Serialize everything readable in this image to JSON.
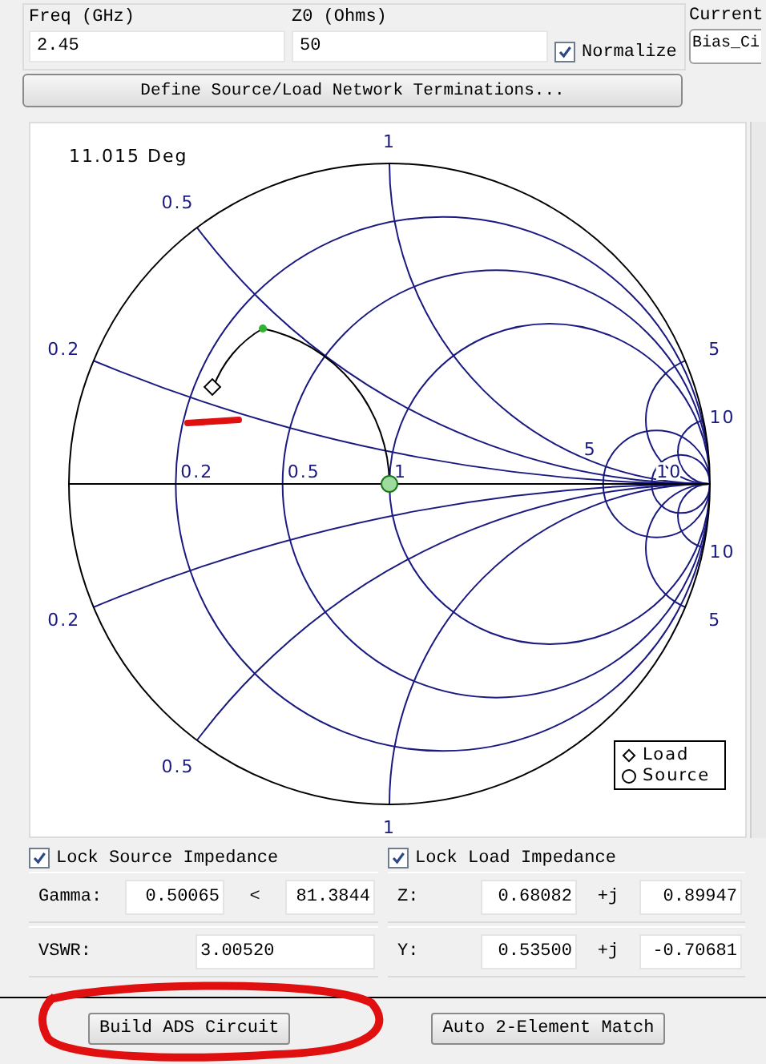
{
  "top": {
    "freq": {
      "label": "Freq (GHz)",
      "value": "2.45"
    },
    "z0": {
      "label": "Z0 (Ohms)",
      "value": "50"
    },
    "normalize": {
      "label": "Normalize",
      "checked": true
    },
    "current": {
      "label": "Current",
      "value": "Bias_Ci"
    }
  },
  "define_button": "Define Source/Load Network Terminations...",
  "chart": {
    "angle": "11.015 Deg",
    "reactance_upper": [
      "0.2",
      "0.5",
      "1",
      "5",
      "10"
    ],
    "reactance_lower": [
      "0.2",
      "0.5",
      "1",
      "5",
      "10"
    ],
    "resistance": [
      "0.2",
      "0.5",
      "1",
      "5",
      "10"
    ],
    "legend": [
      {
        "kind": "diamond",
        "label": "Load"
      },
      {
        "kind": "circle",
        "label": "Source"
      }
    ]
  },
  "source": {
    "lock": {
      "label": "Lock Source Impedance",
      "checked": true
    },
    "rows": [
      {
        "label": "Gamma:",
        "value": "0.50065",
        "sep": "<",
        "value2": "81.3844"
      },
      {
        "label": "VSWR:",
        "value": "3.00520"
      }
    ]
  },
  "load": {
    "lock": {
      "label": "Lock Load Impedance",
      "checked": true
    },
    "rows": [
      {
        "label": "Z:",
        "value": "0.68082",
        "sep": "+j",
        "value2": "0.89947"
      },
      {
        "label": "Y:",
        "value": "0.53500",
        "sep": "+j",
        "value2": "-0.70681"
      }
    ]
  },
  "buttons": [
    "Build ADS Circuit",
    "Auto 2-Element Match"
  ]
}
